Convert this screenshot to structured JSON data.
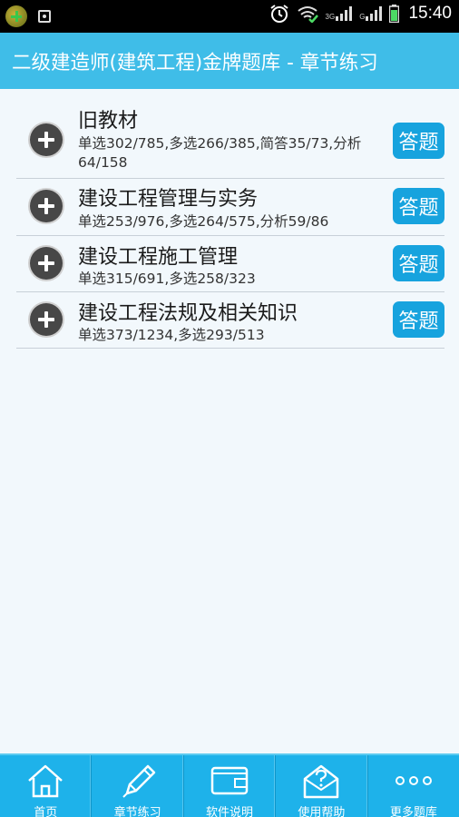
{
  "statusbar": {
    "time": "15:40",
    "network_1": "3G",
    "network_2": "G",
    "icons": [
      "app-icon",
      "screenshot-icon",
      "alarm-icon",
      "wifi-icon",
      "signal-icon",
      "signal-icon",
      "battery-icon"
    ]
  },
  "header": {
    "title": "二级建造师(建筑工程)金牌题库  -  章节练习"
  },
  "chapters": [
    {
      "title": "旧教材",
      "stats": "单选302/785,多选266/385,简答35/73,分析64/158",
      "button": "答题"
    },
    {
      "title": "建设工程管理与实务",
      "stats": "单选253/976,多选264/575,分析59/86",
      "button": "答题"
    },
    {
      "title": "建设工程施工管理",
      "stats": "单选315/691,多选258/323",
      "button": "答题"
    },
    {
      "title": "建设工程法规及相关知识",
      "stats": "单选373/1234,多选293/513",
      "button": "答题"
    }
  ],
  "bottom_nav": [
    {
      "label": "首页",
      "icon": "home-icon"
    },
    {
      "label": "章节练习",
      "icon": "pencil-icon"
    },
    {
      "label": "软件说明",
      "icon": "wallet-icon"
    },
    {
      "label": "使用帮助",
      "icon": "help-mail-icon"
    },
    {
      "label": "更多题库",
      "icon": "more-icon"
    }
  ],
  "colors": {
    "title_bar": "#3fbde8",
    "button": "#17a3de",
    "bottom_nav": "#1eb2ea",
    "background": "#f2f8fc"
  }
}
